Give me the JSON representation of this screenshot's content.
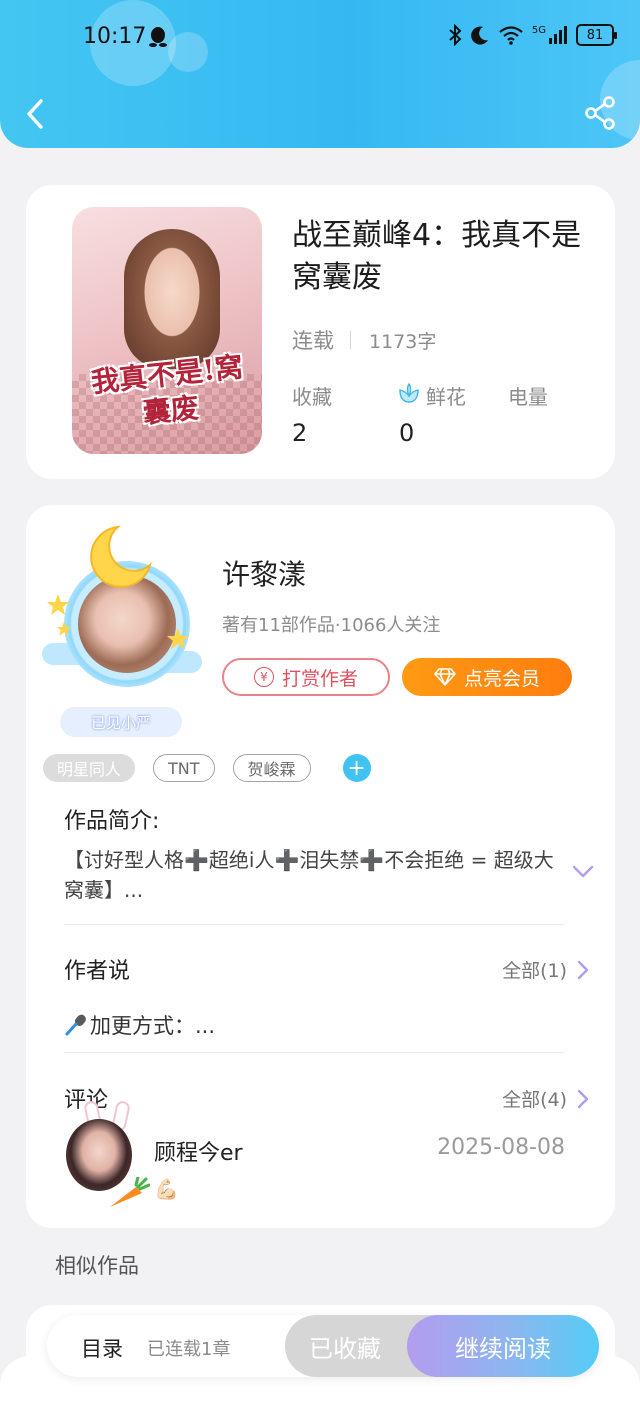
{
  "status_bar": {
    "time": "10:17",
    "network": "5G",
    "battery": "81"
  },
  "book": {
    "cover_text": "我真不是!窝囊废",
    "title": "战至巅峰4：我真不是窝囊废",
    "status": "连载",
    "word_count": "1173字",
    "stats": [
      {
        "label": "收藏",
        "value": "2"
      },
      {
        "label": "鲜花",
        "value": "0"
      },
      {
        "label": "电量",
        "value": ""
      }
    ]
  },
  "author": {
    "name": "许黎漾",
    "info": "著有11部作品·1066人关注",
    "badge": "已见小严",
    "tip_label": "打赏作者",
    "tip_symbol": "¥",
    "vip_label": "点亮会员"
  },
  "tags": [
    {
      "label": "明星同人",
      "style": "filled"
    },
    {
      "label": "TNT",
      "style": "outline"
    },
    {
      "label": "贺峻霖",
      "style": "outline"
    }
  ],
  "tag_add": "+",
  "intro": {
    "title": "作品简介:",
    "text": "【讨好型人格➕超绝i人➕泪失禁➕不会拒绝 = 超级大窝囊】..."
  },
  "author_say": {
    "title": "作者说",
    "all_label": "全部(1)",
    "text": "加更方式：..."
  },
  "comments": {
    "title": "评论",
    "all_label": "全部(4)",
    "items": [
      {
        "user": "顾程今er",
        "date": "2025-08-08",
        "emoji": "💪🏻"
      }
    ]
  },
  "similar": {
    "title": "相似作品"
  },
  "bottom_bar": {
    "toc_label": "目录",
    "chapter_info": "已连载1章",
    "collected_label": "已收藏",
    "continue_label": "继续阅读"
  },
  "colors": {
    "header": "#35b8f2",
    "tip": "#e0525e",
    "vip": "#ff8a10",
    "accent_purple": "#b49cee"
  }
}
